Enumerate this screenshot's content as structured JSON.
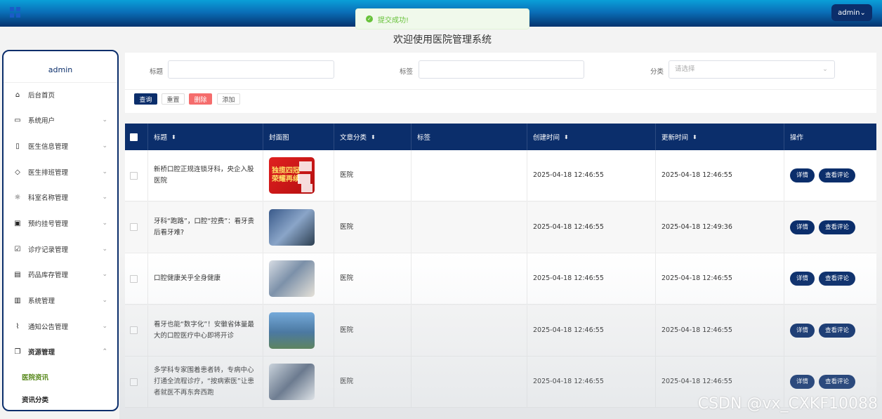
{
  "header": {
    "admin_label": "admin⌄",
    "toast_text": "提交成功!",
    "page_title": "欢迎使用医院管理系统"
  },
  "sidebar": {
    "user": "admin",
    "items": [
      {
        "label": "后台首页",
        "icon": "home-icon"
      },
      {
        "label": "系统用户",
        "icon": "monitor-icon"
      },
      {
        "label": "医生信息管理",
        "icon": "bookmark-icon"
      },
      {
        "label": "医生排班管理",
        "icon": "tag-icon"
      },
      {
        "label": "科室名称管理",
        "icon": "sun-icon"
      },
      {
        "label": "预约挂号管理",
        "icon": "inbox-icon"
      },
      {
        "label": "诊疗记录管理",
        "icon": "clipboard-icon"
      },
      {
        "label": "药品库存管理",
        "icon": "chat-icon"
      },
      {
        "label": "系统管理",
        "icon": "archive-icon"
      },
      {
        "label": "通知公告管理",
        "icon": "paperclip-icon"
      },
      {
        "label": "资源管理",
        "icon": "copy-icon"
      }
    ],
    "sub_items": [
      "医院资讯",
      "资讯分类"
    ],
    "active_color": "#5a8a1f"
  },
  "search": {
    "title_label": "标题",
    "tag_label": "标签",
    "category_label": "分类",
    "category_placeholder": "请选择",
    "buttons": {
      "query": "查询",
      "reset": "重置",
      "delete": "删除",
      "add": "添加"
    }
  },
  "table": {
    "headers": {
      "title": "标题",
      "cover": "封面图",
      "category": "文章分类",
      "tags": "标签",
      "created": "创建时间",
      "updated": "更新时间",
      "actions": "操作"
    },
    "sort_glyph": "⬍",
    "rows": [
      {
        "title": "新桥口腔正规连锁牙科，央企入股医院",
        "category": "医院",
        "tags": "",
        "created": "2025-04-18 12:46:55",
        "updated": "2025-04-18 12:46:55",
        "cover_text": "独揽四冠\n荣耀再续"
      },
      {
        "title": "牙科“跑路”，口腔“控费”：看牙贵后看牙难?",
        "category": "医院",
        "tags": "",
        "created": "2025-04-18 12:46:55",
        "updated": "2025-04-18 12:49:36",
        "cover_text": ""
      },
      {
        "title": "口腔健康关乎全身健康",
        "category": "医院",
        "tags": "",
        "created": "2025-04-18 12:46:55",
        "updated": "2025-04-18 12:46:55",
        "cover_text": ""
      },
      {
        "title": "看牙也能“数字化”！安徽省体量最大的口腔医疗中心即将开诊",
        "category": "医院",
        "tags": "",
        "created": "2025-04-18 12:46:55",
        "updated": "2025-04-18 12:46:55",
        "cover_text": ""
      },
      {
        "title": "多学科专家围着患者转，专病中心打通全流程诊疗，“按病索医”让患者就医不再东奔西跑",
        "category": "医院",
        "tags": "",
        "created": "2025-04-18 12:46:55",
        "updated": "2025-04-18 12:46:55",
        "cover_text": ""
      }
    ],
    "detail_label": "详情",
    "comments_label": "查看评论"
  },
  "watermark": "CSDN @vx_CXKF10088",
  "colors": {
    "primary": "#0b2e6b",
    "danger": "#f56c6c",
    "success": "#67c23a"
  }
}
